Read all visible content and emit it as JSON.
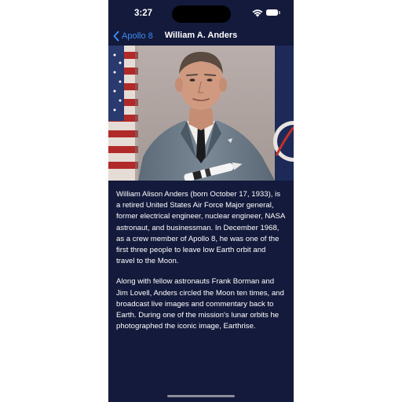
{
  "status_bar": {
    "time": "3:27",
    "icons": [
      "wifi-icon",
      "battery-icon"
    ]
  },
  "nav": {
    "back_label": "Apollo 8",
    "back_icon": "chevron-left-icon",
    "title": "William A. Anders"
  },
  "photo": {
    "subject": "astronaut-portrait"
  },
  "content": {
    "paragraphs": [
      "William Alison Anders (born October 17, 1933), is a retired United States Air Force Major general, former electrical engineer, nuclear engineer, NASA astronaut, and businessman. In December 1968, as a crew member of Apollo 8, he was one of the first three people to leave low Earth orbit and travel to the Moon.",
      "Along with fellow astronauts Frank Borman and Jim Lovell, Anders circled the Moon ten times, and broadcast live images and commentary back to Earth. During one of the mission's lunar orbits he photographed the iconic image, Earthrise."
    ]
  },
  "colors": {
    "background": "#141a3b",
    "accent": "#3d8cf0",
    "text": "#ffffff"
  }
}
